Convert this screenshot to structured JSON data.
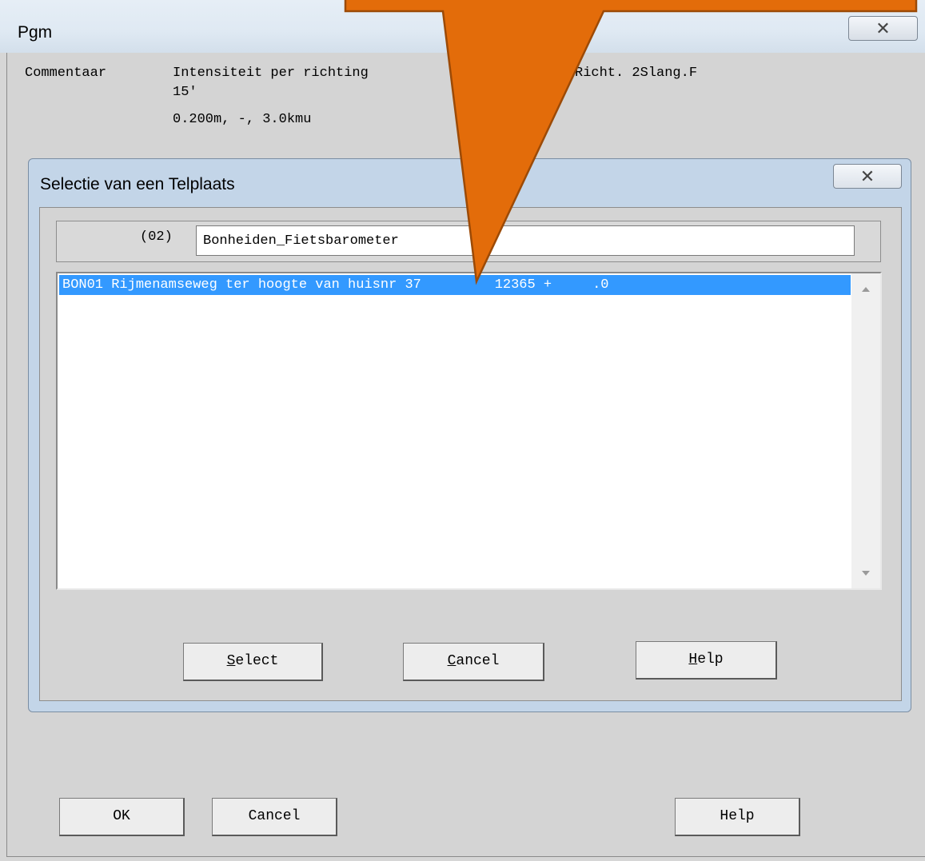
{
  "outer_window": {
    "title": "Pgm",
    "close_glyph": "✕",
    "comment_label": "Commentaar",
    "comment_lines": [
      "Intensiteit per richting",
      "Richt. 2Slang.F",
      "15'",
      "0.200m, -, 3.0kmu"
    ],
    "buttons": {
      "ok": "OK",
      "cancel": "Cancel",
      "help": "Help"
    }
  },
  "dialog": {
    "title": "Selectie van een Telplaats",
    "close_glyph": "✕",
    "field_code": "(02)",
    "field_value": "Bonheiden_Fietsbarometer",
    "list": {
      "items": [
        "BON01 Rijmenamseweg ter hoogte van huisnr 37         12365 +     .0"
      ],
      "selected_index": 0
    },
    "buttons": {
      "select": {
        "mnemonic": "S",
        "rest": "elect"
      },
      "cancel": {
        "mnemonic": "C",
        "rest": "ancel"
      },
      "help": {
        "mnemonic": "H",
        "rest": "elp"
      }
    }
  },
  "colors": {
    "selection": "#3399ff",
    "callout_fill": "#e36c0a",
    "callout_stroke": "#9c4a06"
  }
}
